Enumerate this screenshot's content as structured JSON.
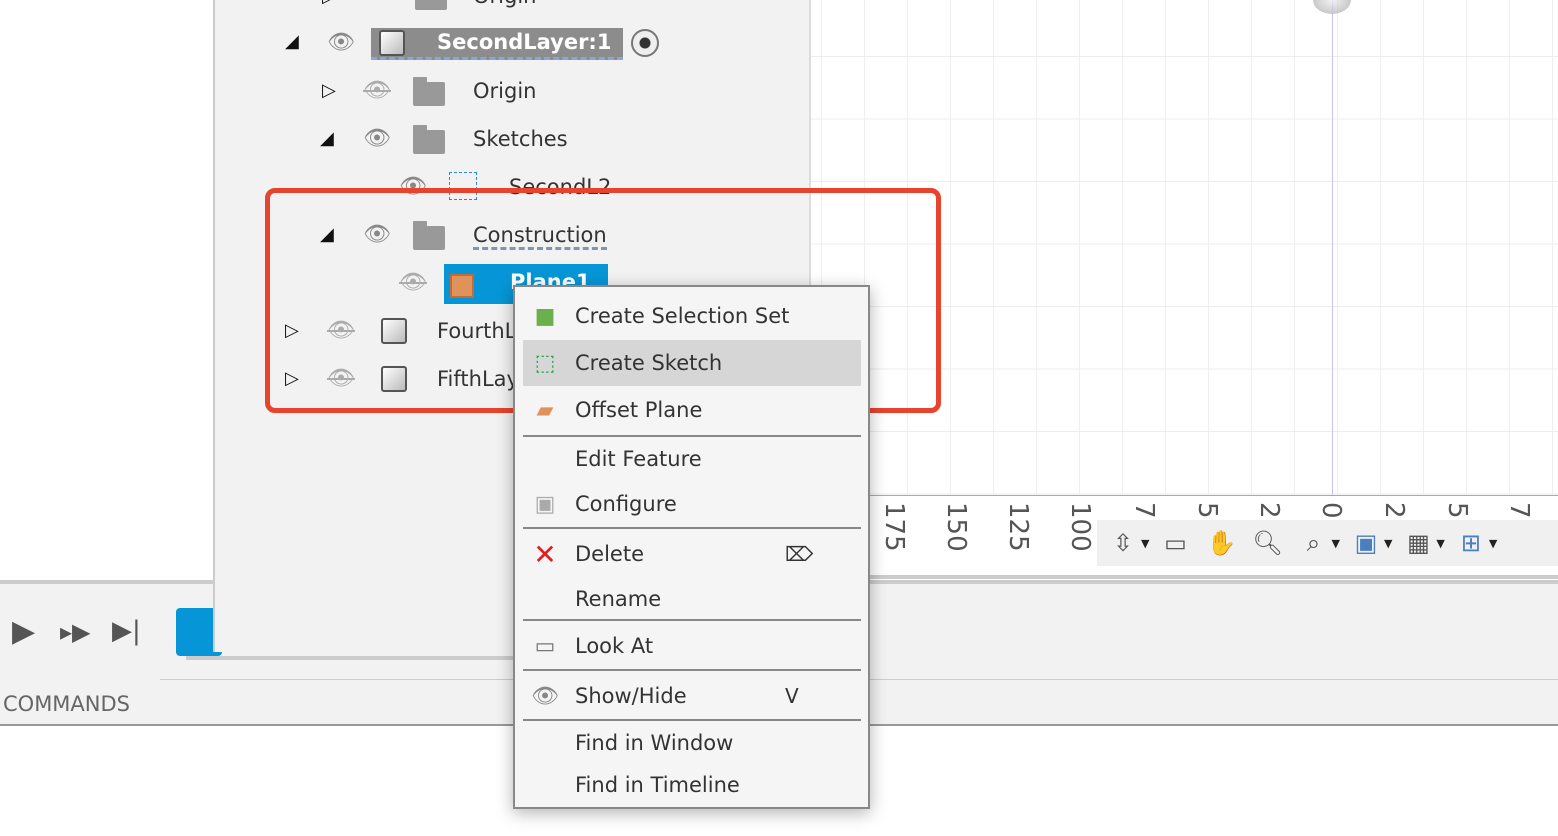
{
  "browser": {
    "rows": [
      {
        "label": "Origin",
        "visible": true
      },
      {
        "label": "SecondLayer:1",
        "visible": true,
        "active": true
      },
      {
        "label": "Origin",
        "visible": false
      },
      {
        "label": "Sketches",
        "visible": true
      },
      {
        "label": "SecondL2",
        "visible": true
      },
      {
        "label": "Construction",
        "visible": true
      },
      {
        "label": "Plane1",
        "visible": false,
        "selected": true
      },
      {
        "label": "FourthL",
        "visible": false
      },
      {
        "label": "FifthLay",
        "visible": false
      }
    ]
  },
  "ruler": {
    "labels": [
      "175",
      "150",
      "125",
      "100",
      "7",
      "5",
      "2",
      "0",
      "2",
      "5",
      "7"
    ]
  },
  "navbar": {
    "icons": [
      "orbit-icon",
      "look-at-icon",
      "pan-icon",
      "zoom-icon",
      "fit-icon",
      "display-settings-icon",
      "grid-icon",
      "viewports-icon"
    ]
  },
  "timeline": {
    "label": "COMMANDS"
  },
  "menu": {
    "items": [
      {
        "label": "Create Selection Set",
        "icon": "selection-set-icon"
      },
      {
        "label": "Create Sketch",
        "icon": "create-sketch-icon",
        "hovered": true
      },
      {
        "label": "Offset Plane",
        "icon": "offset-plane-icon"
      },
      {
        "label": "Edit Feature"
      },
      {
        "label": "Configure",
        "icon": "configure-icon"
      },
      {
        "label": "Delete",
        "icon": "delete-icon",
        "shortcut": "⌦"
      },
      {
        "label": "Rename"
      },
      {
        "label": "Look At",
        "icon": "look-at-icon"
      },
      {
        "label": "Show/Hide",
        "icon": "eye-icon",
        "shortcut": "V"
      },
      {
        "label": "Find in Window"
      },
      {
        "label": "Find in Timeline"
      }
    ]
  },
  "colors": {
    "highlight": "#e8432d",
    "selection": "#0696d7",
    "hover": "#d6d6d6"
  }
}
